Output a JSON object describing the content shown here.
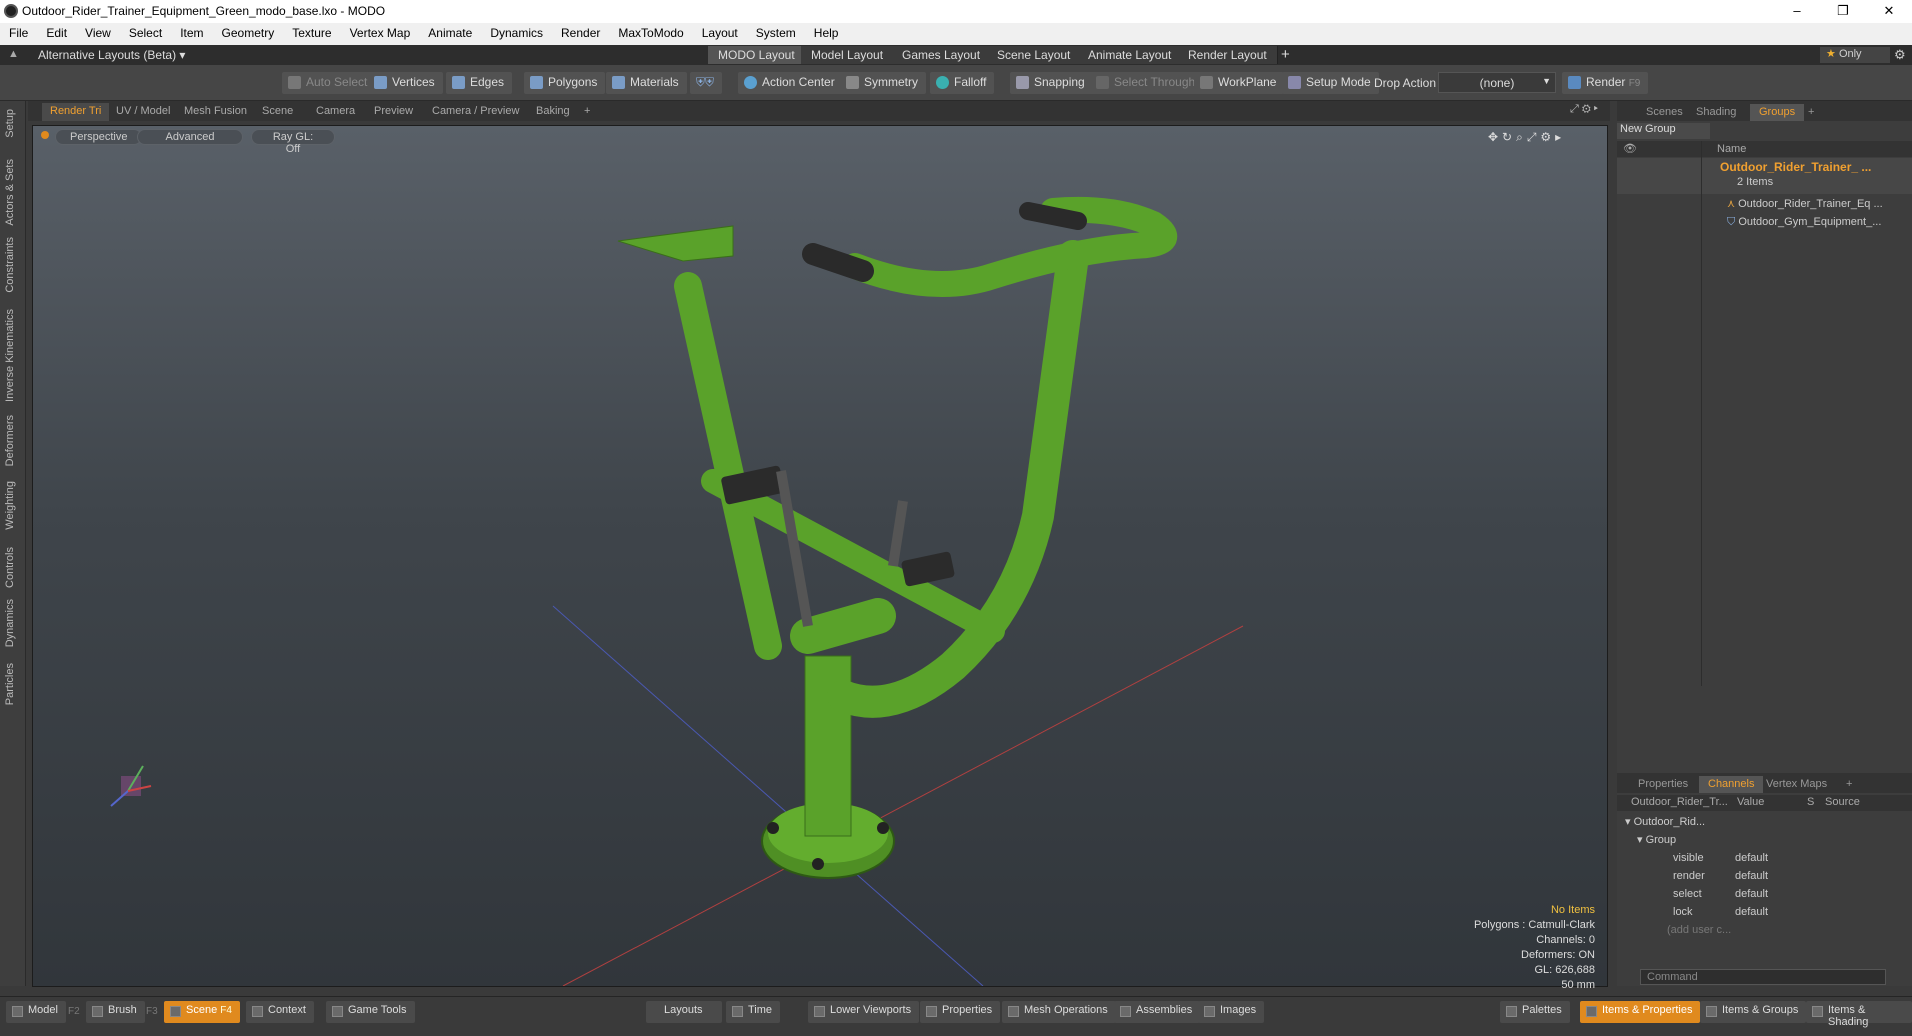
{
  "window": {
    "title": "Outdoor_Rider_Trainer_Equipment_Green_modo_base.lxo - MODO"
  },
  "menu": [
    "File",
    "Edit",
    "View",
    "Select",
    "Item",
    "Geometry",
    "Texture",
    "Vertex Map",
    "Animate",
    "Dynamics",
    "Render",
    "MaxToModo",
    "Layout",
    "System",
    "Help"
  ],
  "layouts": {
    "switcher": "Alternative Layouts (Beta)",
    "tabs": [
      "MODO Layout",
      "Model Layout",
      "Games Layout",
      "Scene Layout",
      "Animate Layout",
      "Render Layout"
    ],
    "add": "+",
    "only": "Only"
  },
  "toolbar": {
    "auto_select": "Auto Select",
    "vertices": "Vertices",
    "edges": "Edges",
    "polygons": "Polygons",
    "materials": "Materials",
    "action_center": "Action Center",
    "symmetry": "Symmetry",
    "falloff": "Falloff",
    "snapping": "Snapping",
    "select_through": "Select Through",
    "workplane": "WorkPlane",
    "setup_mode": "Setup Mode",
    "drop_action": "Drop Action",
    "drop_value": "(none)",
    "render": "Render",
    "render_key": "F9"
  },
  "left_tabs": [
    "Setup",
    "Actors & Sets",
    "Constraints",
    "Inverse Kinematics",
    "Deformers",
    "Weighting",
    "Controls",
    "Dynamics",
    "Particles"
  ],
  "viewport_tabs": [
    "Render Tri",
    "UV / Model",
    "Mesh Fusion",
    "Scene",
    "Camera",
    "Preview",
    "Camera / Preview",
    "Baking",
    "+"
  ],
  "viewport": {
    "view": "Perspective",
    "shading": "Advanced",
    "raygl": "Ray GL: Off",
    "info": {
      "items": "No Items",
      "polygons": "Polygons : Catmull-Clark",
      "channels": "Channels: 0",
      "deformers": "Deformers: ON",
      "gl": "GL: 626,688",
      "size": "50 mm"
    }
  },
  "scene_panel": {
    "tabs": [
      "Scenes",
      "Shading",
      "Groups",
      "+"
    ],
    "new_group": "New Group",
    "name_col": "Name",
    "group_name": "Outdoor_Rider_Trainer_ ...",
    "group_count": "2 Items",
    "children": [
      "Outdoor_Rider_Trainer_Eq ...",
      "Outdoor_Gym_Equipment_..."
    ]
  },
  "channels_panel": {
    "tabs": [
      "Properties",
      "Channels",
      "Vertex Maps",
      "+"
    ],
    "cols": [
      "Outdoor_Rider_Tr...",
      "Value",
      "S",
      "Source"
    ],
    "item": "Outdoor_Rid...",
    "group": "Group",
    "rows": [
      {
        "name": "visible",
        "value": "default"
      },
      {
        "name": "render",
        "value": "default"
      },
      {
        "name": "select",
        "value": "default"
      },
      {
        "name": "lock",
        "value": "default"
      }
    ],
    "add_user": "(add user c...",
    "command_placeholder": "Command"
  },
  "bottom": {
    "left": [
      {
        "label": "Model",
        "key": "F2"
      },
      {
        "label": "Brush",
        "key": "F3"
      },
      {
        "label": "Scene",
        "key": "F4"
      },
      {
        "label": "Context",
        "key": ""
      },
      {
        "label": "Game Tools",
        "key": ""
      }
    ],
    "center": [
      "Layouts",
      "Time",
      "Lower Viewports",
      "Properties",
      "Mesh Operations",
      "Assemblies",
      "Images"
    ],
    "right": [
      "Palettes",
      "Items & Properties",
      "Items & Groups",
      "Items & Shading"
    ]
  },
  "colors": {
    "accent": "#e08a1e",
    "model_green": "#5aa22a"
  }
}
